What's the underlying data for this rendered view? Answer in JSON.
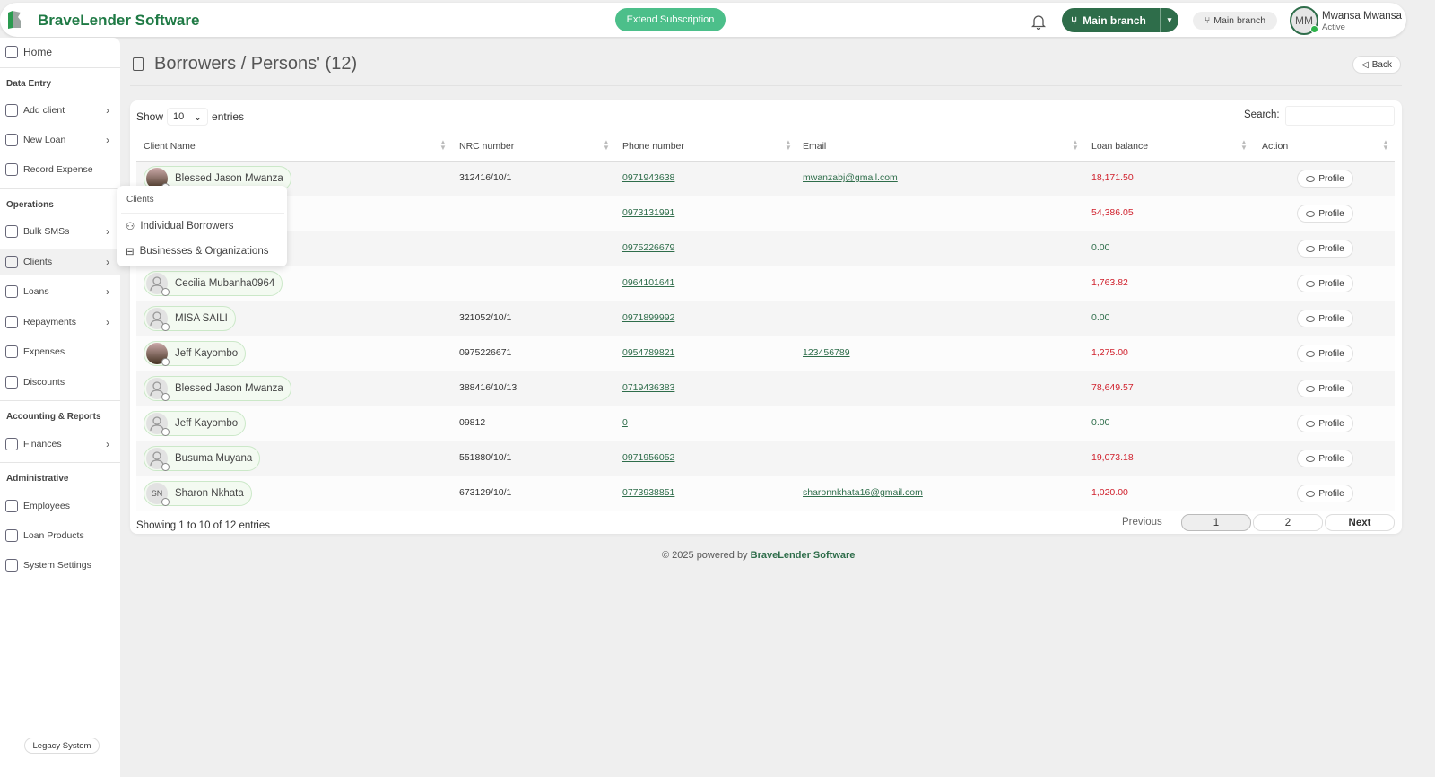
{
  "header": {
    "brand": "BraveLender Software",
    "extend": "Extend Subscription",
    "branch_button": "Main branch",
    "branch_pill": "Main branch",
    "avatar_initials": "MM",
    "user_name": "Mwansa Mwansa",
    "user_status": "Active"
  },
  "sidebar": {
    "home": "Home",
    "sections": [
      {
        "title": "Data Entry",
        "items": [
          {
            "label": "Add client",
            "chev": true,
            "icon": "add-user-icon"
          },
          {
            "label": "New Loan",
            "chev": true,
            "icon": "folder-plus-icon"
          },
          {
            "label": "Record Expense",
            "chev": false,
            "icon": "wallet-icon"
          }
        ]
      },
      {
        "title": "Operations",
        "items": [
          {
            "label": "Bulk SMSs",
            "chev": true,
            "icon": "message-icon"
          },
          {
            "label": "Clients",
            "chev": true,
            "icon": "users-icon",
            "active": true
          },
          {
            "label": "Loans",
            "chev": true,
            "icon": "ledger-icon"
          },
          {
            "label": "Repayments",
            "chev": true,
            "icon": "headset-icon"
          },
          {
            "label": "Expenses",
            "chev": false,
            "icon": "wallet-icon"
          },
          {
            "label": "Discounts",
            "chev": false,
            "icon": "discount-icon"
          }
        ]
      },
      {
        "title": "Accounting & Reports",
        "items": [
          {
            "label": "Finances",
            "chev": true,
            "icon": "chart-icon"
          }
        ]
      },
      {
        "title": "Administrative",
        "items": [
          {
            "label": "Employees",
            "chev": false,
            "icon": "badge-icon"
          },
          {
            "label": "Loan Products",
            "chev": false,
            "icon": "link-icon"
          },
          {
            "label": "System Settings",
            "chev": false,
            "icon": "gear-icon"
          }
        ]
      }
    ],
    "legacy": "Legacy System"
  },
  "popup": {
    "title": "Clients",
    "items": [
      "Individual Borrowers",
      "Businesses & Organizations"
    ]
  },
  "page": {
    "title": "Borrowers / Persons' (12)",
    "back": "Back"
  },
  "table": {
    "show": "Show",
    "entries_value": "10",
    "entries": "entries",
    "search_label": "Search:",
    "columns": [
      "Client Name",
      "NRC number",
      "Phone number",
      "Email",
      "Loan balance",
      "Action"
    ],
    "rows": [
      {
        "name": "Blessed Jason Mwanza",
        "avatar": "photo",
        "nrc": "312416/10/1",
        "phone": "0971943638",
        "email": "mwanzabj@gmail.com",
        "balance": "18,171.50"
      },
      {
        "name": "",
        "avatar": "",
        "nrc": "",
        "phone": "0973131991",
        "email": "",
        "balance": "54,386.05"
      },
      {
        "name": "",
        "avatar": "",
        "nrc": "",
        "phone": "0975226679",
        "email": "",
        "balance": "0.00"
      },
      {
        "name": "Cecilia Mubanha0964",
        "avatar": "",
        "nrc": "",
        "phone": "0964101641",
        "email": "",
        "balance": "1,763.82"
      },
      {
        "name": "MISA SAILI",
        "avatar": "",
        "nrc": "321052/10/1",
        "phone": "0971899992",
        "email": "",
        "balance": "0.00"
      },
      {
        "name": "Jeff Kayombo",
        "avatar": "photo",
        "nrc": "0975226671",
        "phone": "0954789821",
        "email": "123456789",
        "balance": "1,275.00"
      },
      {
        "name": "Blessed Jason Mwanza",
        "avatar": "",
        "nrc": "388416/10/13",
        "phone": "0719436383",
        "email": "",
        "balance": "78,649.57"
      },
      {
        "name": "Jeff Kayombo",
        "avatar": "",
        "nrc": "09812",
        "phone": "0",
        "email": "",
        "balance": "0.00"
      },
      {
        "name": "Busuma Muyana",
        "avatar": "",
        "nrc": "551880/10/1",
        "phone": "0971956052",
        "email": "",
        "balance": "19,073.18"
      },
      {
        "name": "Sharon Nkhata",
        "avatar": "SN",
        "nrc": "673129/10/1",
        "phone": "0773938851",
        "email": "sharonnkhata16@gmail.com",
        "balance": "1,020.00"
      }
    ],
    "action_label": "Profile",
    "showing": "Showing 1 to 10 of 12 entries",
    "previous": "Previous",
    "pages": [
      "1",
      "2"
    ],
    "next": "Next"
  },
  "footer": {
    "prefix": "© 2025 powered by",
    "brand": "BraveLender Software"
  },
  "colors": {
    "brand": "#1f7a45",
    "negative": "#d0202c",
    "accent": "#4cbf8a"
  }
}
